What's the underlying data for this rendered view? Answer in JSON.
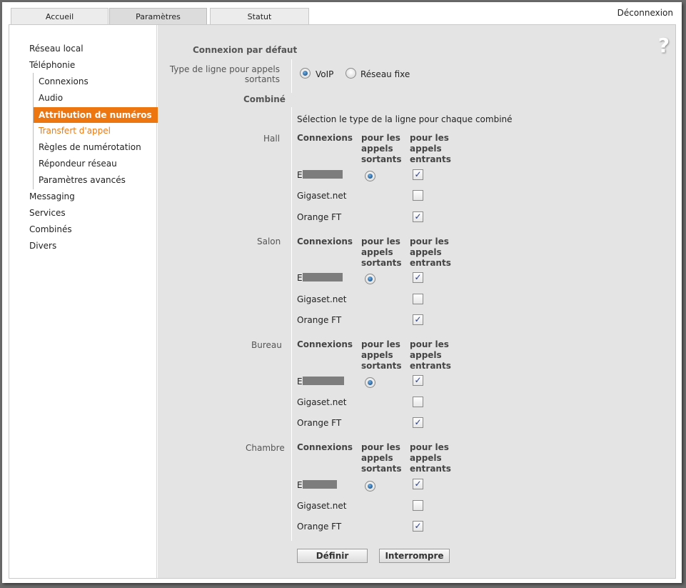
{
  "tabs": [
    "Accueil",
    "Paramètres",
    "Statut"
  ],
  "logout": "Déconnexion",
  "sidebar": {
    "items": [
      "Réseau local",
      "Téléphonie",
      "Connexions",
      "Audio",
      "Attribution de numéros",
      "Transfert d'appel",
      "Règles de numérotation",
      "Répondeur réseau",
      "Paramètres avancés",
      "Messaging",
      "Services",
      "Combinés",
      "Divers"
    ]
  },
  "content": {
    "section_default": "Connexion par défaut",
    "line_type_label": "Type de ligne pour appels sortants",
    "options": [
      "VoIP",
      "Réseau fixe"
    ],
    "section_handsets": "Combiné",
    "instruction": "Sélection le type de la ligne pour chaque combiné",
    "col_headers": {
      "connections": "Connexions",
      "outgoing": "pour les appels sortants",
      "incoming": "pour les appels entrants"
    },
    "rows": [
      "E",
      "Gigaset.net",
      "Orange FT"
    ],
    "handsets": [
      "Hall",
      "Salon",
      "Bureau",
      "Chambre"
    ],
    "buttons": {
      "define": "Définir",
      "cancel": "Interrompre"
    },
    "help": "?"
  }
}
